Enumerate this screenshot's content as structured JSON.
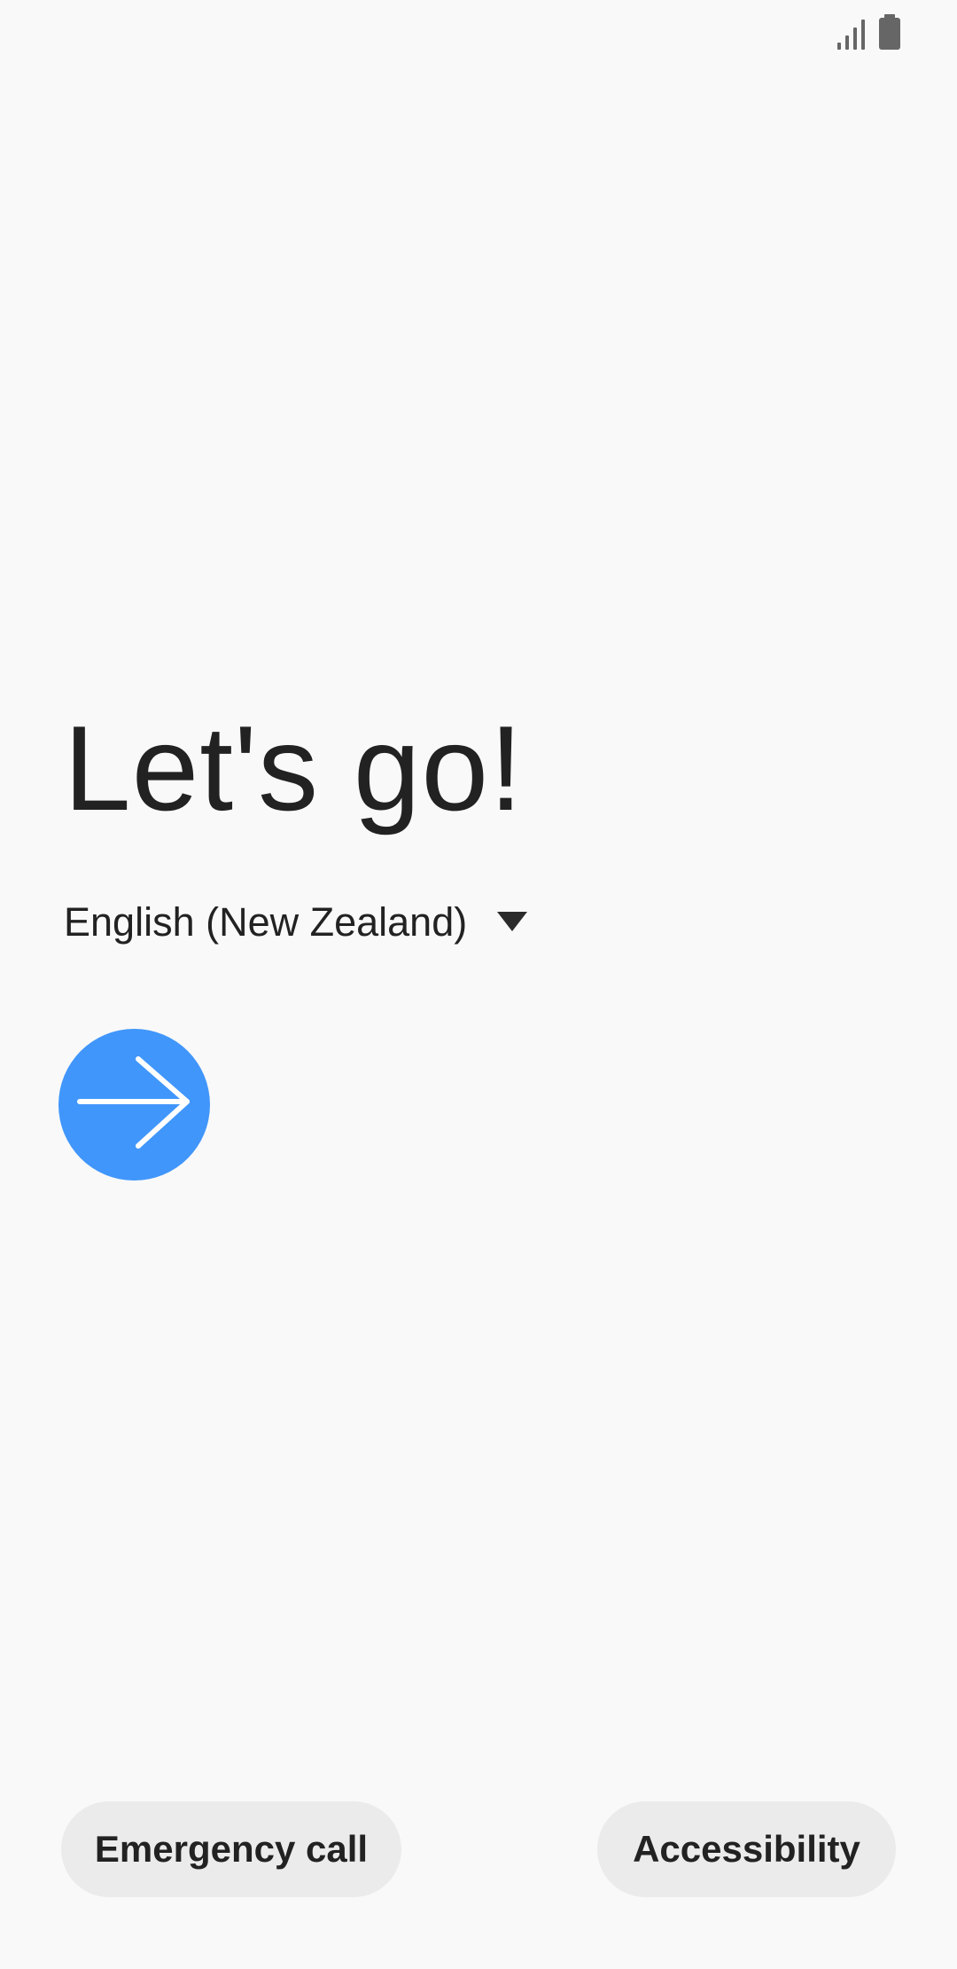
{
  "status_bar": {
    "icons": [
      "signal-icon",
      "battery-icon"
    ],
    "icon_color": "#666666"
  },
  "main": {
    "title": "Let's go!",
    "language": {
      "selected": "English (New Zealand)",
      "icon": "dropdown-triangle-icon"
    },
    "next_button": {
      "icon": "arrow-right-icon",
      "color": "#4096fb"
    }
  },
  "footer": {
    "emergency_call_label": "Emergency call",
    "accessibility_label": "Accessibility",
    "button_color": "#ebebeb"
  },
  "colors": {
    "background": "#f9f9f9",
    "text": "#222222",
    "accent": "#4096fb"
  }
}
